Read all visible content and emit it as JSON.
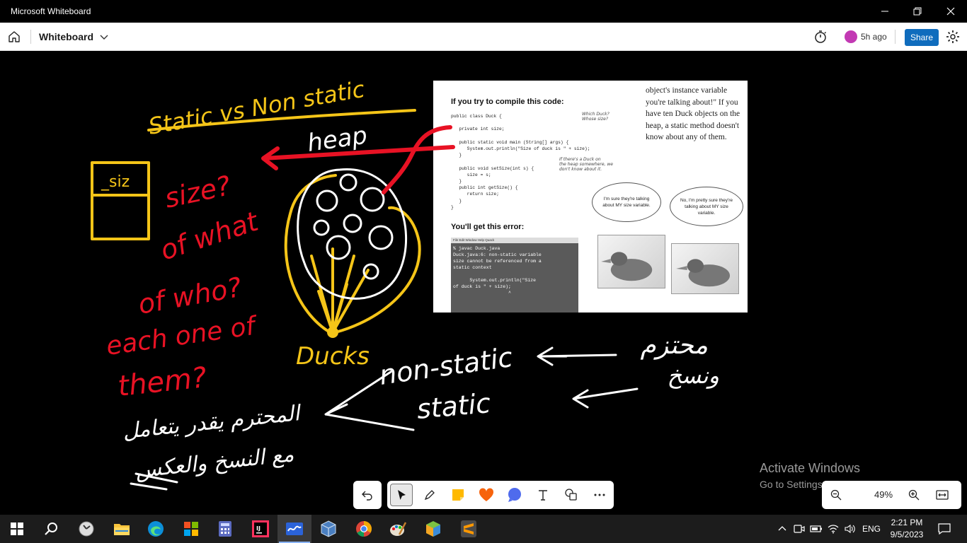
{
  "window": {
    "title": "Microsoft Whiteboard"
  },
  "appbar": {
    "board_name": "Whiteboard",
    "last_edit": "5h ago",
    "share_label": "Share"
  },
  "colors": {
    "ink_yellow": "#f5c518",
    "ink_red": "#e81224",
    "ink_white": "#ffffff",
    "share_blue": "#0f6cbd",
    "avatar": "#c239b3"
  },
  "book": {
    "heading1": "If you try to compile this code:",
    "code": "public class Duck {\n\n   private int size;\n\n   public static void main (String[] args) {\n      System.out.println(\"Size of duck is \" + size);\n   }\n\n   public void setSize(int s) {\n      size = s;\n   }\n   public int getSize() {\n      return size;\n   }\n}",
    "heading2": "You'll get this error:",
    "terminal_menu": "File  Edit  Window  Help  Quack",
    "terminal_output": "% javac Duck.java\nDuck.java:6: non-static variable\nsize cannot be referenced from a\nstatic context\n\n      System.out.println(\"Size\nof duck is \" + size);\n                    ^",
    "sidebar_text": "object's instance variable you're talking about!\" If you have ten Duck objects on the heap, a static method doesn't know about any of them.",
    "note1": "Which Duck?\nWhose size?",
    "note2": "If there's a Duck on\nthe heap somewhere, we\ndon't know about it.",
    "bubble1": "I'm sure they're talking about MY size variable.",
    "bubble2": "No, I'm pretty sure they're talking about MY size variable."
  },
  "ink_text": {
    "title": "Static vs Non static",
    "box_label": "_siz",
    "heap": "heap",
    "ducks": "Ducks",
    "q1": "size?",
    "q2": "of what",
    "q3": "of who?",
    "q4": "each one of",
    "q5": "them?",
    "non_static": "non-static",
    "static": "static",
    "arabic_right_1": "محتزم",
    "arabic_right_2": "ونسخ",
    "arabic_left_1": "المحترم يقدر يتعامل",
    "arabic_left_2": "مع النسخ والعكس"
  },
  "watermark": {
    "line1": "Activate Windows",
    "line2": "Go to Settings to activate Windows."
  },
  "toolbar": {
    "tools": [
      "undo-icon",
      "select-icon",
      "pen-icon",
      "sticky-note-icon",
      "reaction-icon",
      "shape-icon",
      "text-icon",
      "copy-shapes-icon",
      "more-icon"
    ]
  },
  "zoom": {
    "value": "49%"
  },
  "taskbar": {
    "language": "ENG",
    "time": "2:21 PM",
    "date": "9/5/2023"
  }
}
